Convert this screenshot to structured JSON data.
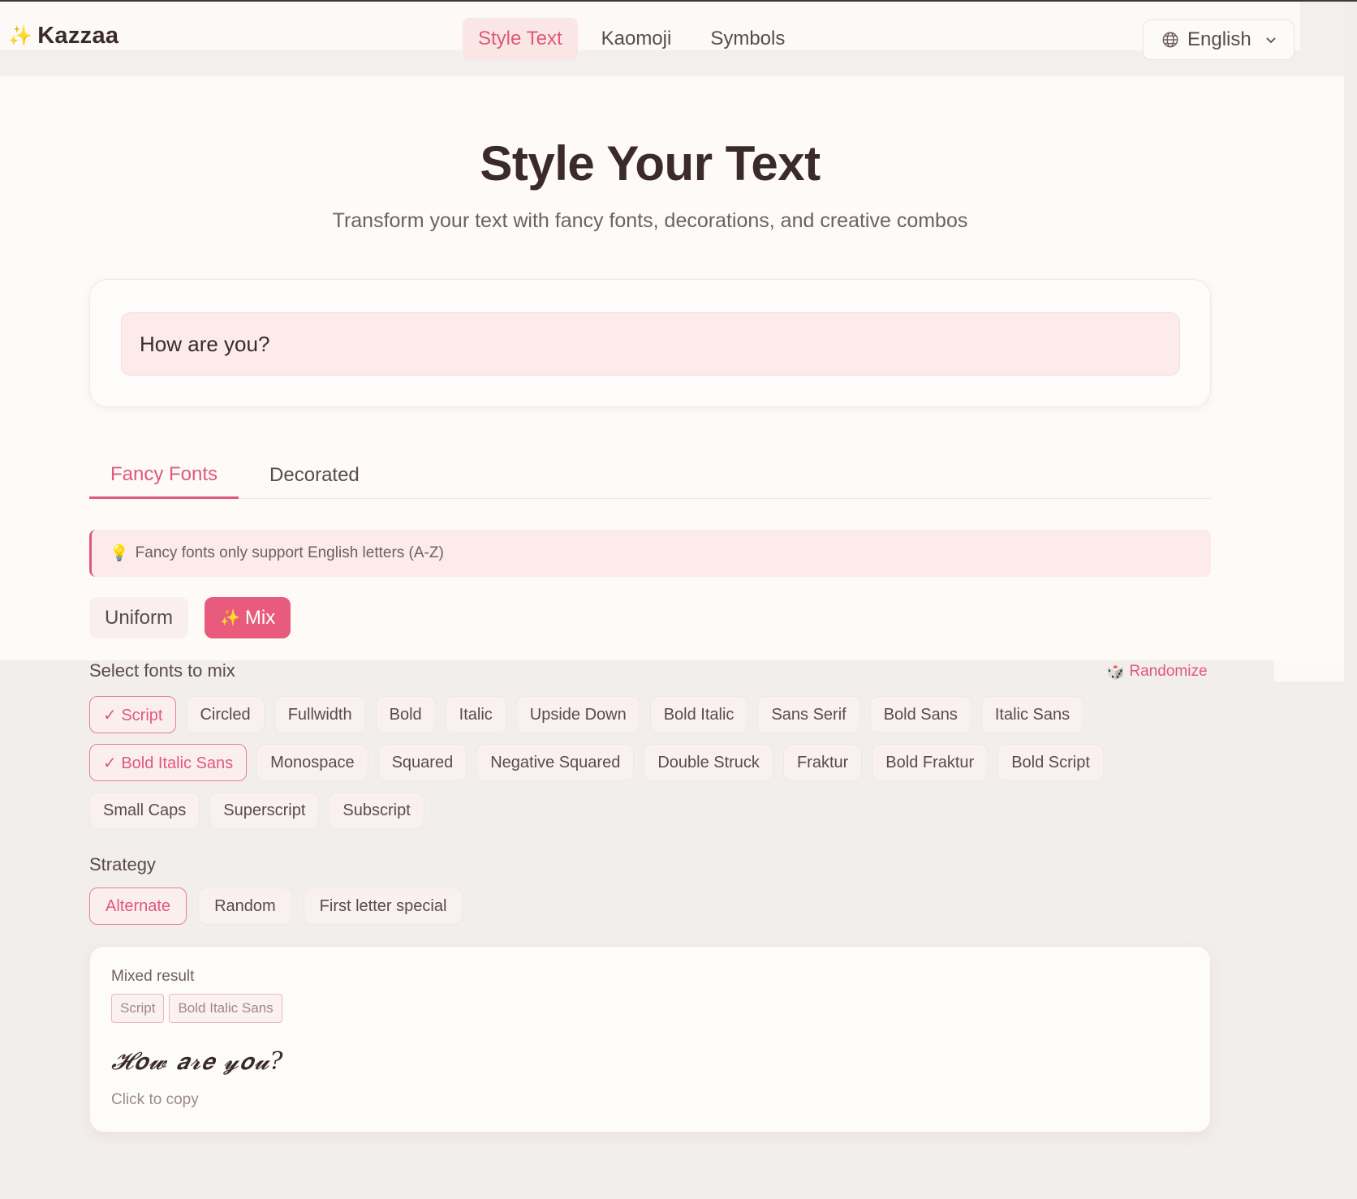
{
  "header": {
    "logo_text": "Kazzaa",
    "nav": [
      {
        "label": "Style Text",
        "active": true
      },
      {
        "label": "Kaomoji",
        "active": false
      },
      {
        "label": "Symbols",
        "active": false
      }
    ],
    "language": "English"
  },
  "hero": {
    "title": "Style Your Text",
    "subtitle": "Transform your text with fancy fonts, decorations, and creative combos"
  },
  "input": {
    "value": "How are you?"
  },
  "tabs": [
    {
      "label": "Fancy Fonts",
      "active": true
    },
    {
      "label": "Decorated",
      "active": false
    }
  ],
  "notice": {
    "text": "Fancy fonts only support English letters (A-Z)"
  },
  "mode": {
    "uniform_label": "Uniform",
    "mix_label": "Mix",
    "selected": "Mix"
  },
  "fonts": {
    "section_label": "Select fonts to mix",
    "randomize_label": "Randomize",
    "row1": [
      {
        "label": "✓ Script",
        "selected": true
      },
      {
        "label": "Circled",
        "selected": false
      },
      {
        "label": "Fullwidth",
        "selected": false
      },
      {
        "label": "Bold",
        "selected": false
      },
      {
        "label": "Italic",
        "selected": false
      },
      {
        "label": "Upside Down",
        "selected": false
      },
      {
        "label": "Bold Italic",
        "selected": false
      },
      {
        "label": "Sans Serif",
        "selected": false
      },
      {
        "label": "Bold Sans",
        "selected": false
      },
      {
        "label": "Italic Sans",
        "selected": false
      }
    ],
    "row2": [
      {
        "label": "✓ Bold Italic Sans",
        "selected": true
      },
      {
        "label": "Monospace",
        "selected": false
      },
      {
        "label": "Squared",
        "selected": false
      },
      {
        "label": "Negative Squared",
        "selected": false
      },
      {
        "label": "Double Struck",
        "selected": false
      },
      {
        "label": "Fraktur",
        "selected": false
      },
      {
        "label": "Bold Fraktur",
        "selected": false
      },
      {
        "label": "Bold Script",
        "selected": false
      }
    ],
    "row3": [
      {
        "label": "Small Caps",
        "selected": false
      },
      {
        "label": "Superscript",
        "selected": false
      },
      {
        "label": "Subscript",
        "selected": false
      }
    ]
  },
  "strategy": {
    "section_label": "Strategy",
    "options": [
      {
        "label": "Alternate",
        "selected": true
      },
      {
        "label": "Random",
        "selected": false
      },
      {
        "label": "First letter special",
        "selected": false
      }
    ]
  },
  "result": {
    "title": "Mixed result",
    "tags": [
      "Script",
      "Bold Italic Sans"
    ],
    "text": "𝓗𝙤𝔀 𝙖𝓻𝙚 𝔂𝙤𝓾?",
    "copy_hint": "Click to copy"
  },
  "colors": {
    "accent": "#e0587a",
    "accent_strong": "#e85b7c",
    "page_bg": "#fdfaf8"
  }
}
